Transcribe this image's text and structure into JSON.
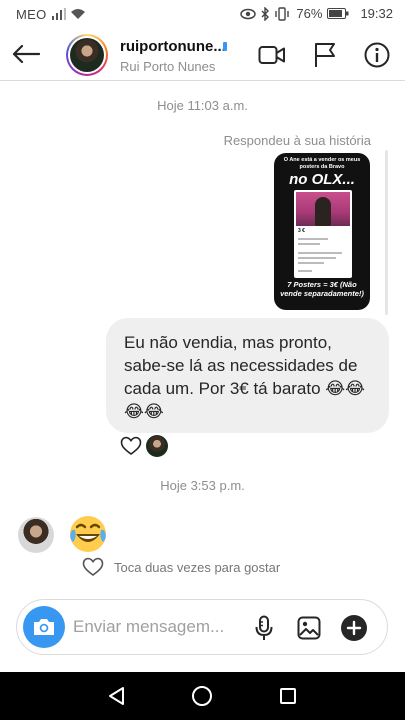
{
  "status_bar": {
    "carrier": "MEO",
    "battery": "76%",
    "time": "19:32"
  },
  "header": {
    "username": "ruiportonune...",
    "full_name": "Rui Porto Nunes",
    "icons": [
      "back-arrow-icon",
      "video-camera-icon",
      "flag-icon",
      "info-icon"
    ]
  },
  "chat": {
    "timestamp_1": "Hoje 11:03 a.m.",
    "story_reply_label": "Respondeu à sua história",
    "story_preview": {
      "top_text": "O Ane está a vender os meus posters da Bravo",
      "headline": "no OLX...",
      "price": "3 €",
      "bottom_text": "7 Posters = 3€ (Não vende separadamente!)"
    },
    "sent_message": "Eu não vendia, mas pronto, sabe-se lá as necessidades de cada um. Por 3€ tá barato 😂😂😂😂",
    "timestamp_2": "Hoje 3:53 p.m.",
    "received_emoji": "😂",
    "like_hint": "Toca duas vezes para gostar"
  },
  "composer": {
    "placeholder": "Enviar mensagem..."
  },
  "colors": {
    "accent": "#3897f0",
    "bubble": "#efefef",
    "muted_text": "#8e8e8e"
  }
}
